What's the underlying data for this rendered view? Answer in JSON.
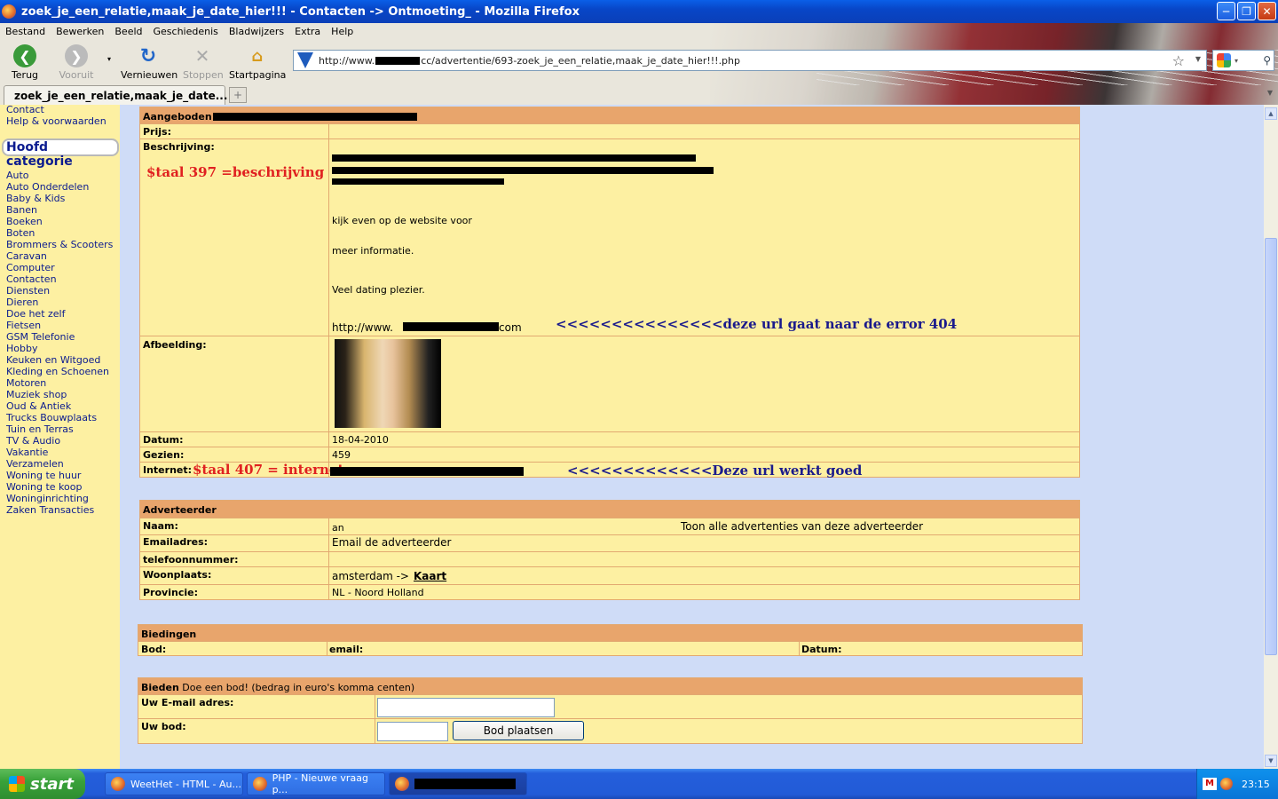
{
  "window": {
    "title": "zoek_je_een_relatie,maak_je_date_hier!!! - Contacten -> Ontmoeting_ - Mozilla Firefox"
  },
  "menu": [
    "Bestand",
    "Bewerken",
    "Beeld",
    "Geschiedenis",
    "Bladwijzers",
    "Extra",
    "Help"
  ],
  "nav": {
    "back": "Terug",
    "forward": "Vooruit",
    "reload": "Vernieuwen",
    "stop": "Stoppen",
    "home": "Startpagina"
  },
  "url": {
    "prefix": "http://www.",
    "suffix": "cc/advertentie/693-zoek_je_een_relatie,maak_je_date_hier!!!.php"
  },
  "tab": {
    "label": "zoek_je_een_relatie,maak_je_date..."
  },
  "sidebar": {
    "top_links": [
      "Contact",
      "Help & voorwaarden"
    ],
    "category_header": "Hoofd categorie",
    "categories": [
      "Auto",
      "Auto Onderdelen",
      "Baby & Kids",
      "Banen",
      "Boeken",
      "Boten",
      "Brommers & Scooters",
      "Caravan",
      "Computer",
      "Contacten",
      "Diensten",
      "Dieren",
      "Doe het zelf",
      "Fietsen",
      "GSM Telefonie",
      "Hobby",
      "Keuken en Witgoed",
      "Kleding en Schoenen",
      "Motoren",
      "Muziek shop",
      "Oud & Antiek",
      "Trucks Bouwplaats",
      "Tuin en Terras",
      "TV & Audio",
      "Vakantie",
      "Verzamelen",
      "Woning te huur",
      "Woning te koop",
      "Woninginrichting",
      "Zaken Transacties"
    ]
  },
  "ad": {
    "offered_label": "Aangeboden:",
    "price_label": "Prijs:",
    "description_label": "Beschrijving:",
    "description_annotation": "$taal 397 =beschrijving",
    "description_lines": [
      "kijk even op de website voor",
      "meer informatie.",
      "Veel dating plezier."
    ],
    "desc_url_prefix": "http://www.",
    "desc_url_suffix": "com",
    "desc_url_annotation": "<<<<<<<<<<<<<<<deze url gaat naar de error 404",
    "image_label": "Afbeelding:",
    "date_label": "Datum:",
    "date_value": "18-04-2010",
    "views_label": "Gezien:",
    "views_value": "459",
    "internet_label": "Internet:",
    "internet_annotation": "$taal 407 = internet",
    "internet_url_annotation": "<<<<<<<<<<<<<Deze url werkt goed"
  },
  "advertiser": {
    "header": "Adverteerder",
    "name_label": "Naam:",
    "name_value": "an",
    "all_ads_link": "Toon alle advertenties van deze adverteerder",
    "email_label": "Emailadres:",
    "email_link": "Email de adverteerder",
    "phone_label": "telefoonnummer:",
    "city_label": "Woonplaats:",
    "city_value": "amsterdam ->",
    "map_link": "Kaart",
    "province_label": "Provincie:",
    "province_value": "NL - Noord Holland"
  },
  "bids": {
    "header": "Biedingen",
    "col_bid": "Bod:",
    "col_email": "email:",
    "col_date": "Datum:"
  },
  "bid_form": {
    "header_bold": "Bieden",
    "header_text": "Doe een bod! (bedrag in euro's komma centen)",
    "email_label": "Uw E-mail adres:",
    "bid_label": "Uw bod:",
    "submit": "Bod plaatsen"
  },
  "taskbar": {
    "start": "start",
    "tasks": [
      "WeetHet - HTML - Au...",
      "PHP - Nieuwe vraag p..."
    ],
    "clock": "23:15"
  },
  "colors": {
    "panel_bg": "#fdf0a2",
    "header_bg": "#e8a56c",
    "border": "#e2a971",
    "page_bg": "#cfdcf7",
    "annotation_red": "#e02020",
    "annotation_blue": "#1a1a8c"
  }
}
